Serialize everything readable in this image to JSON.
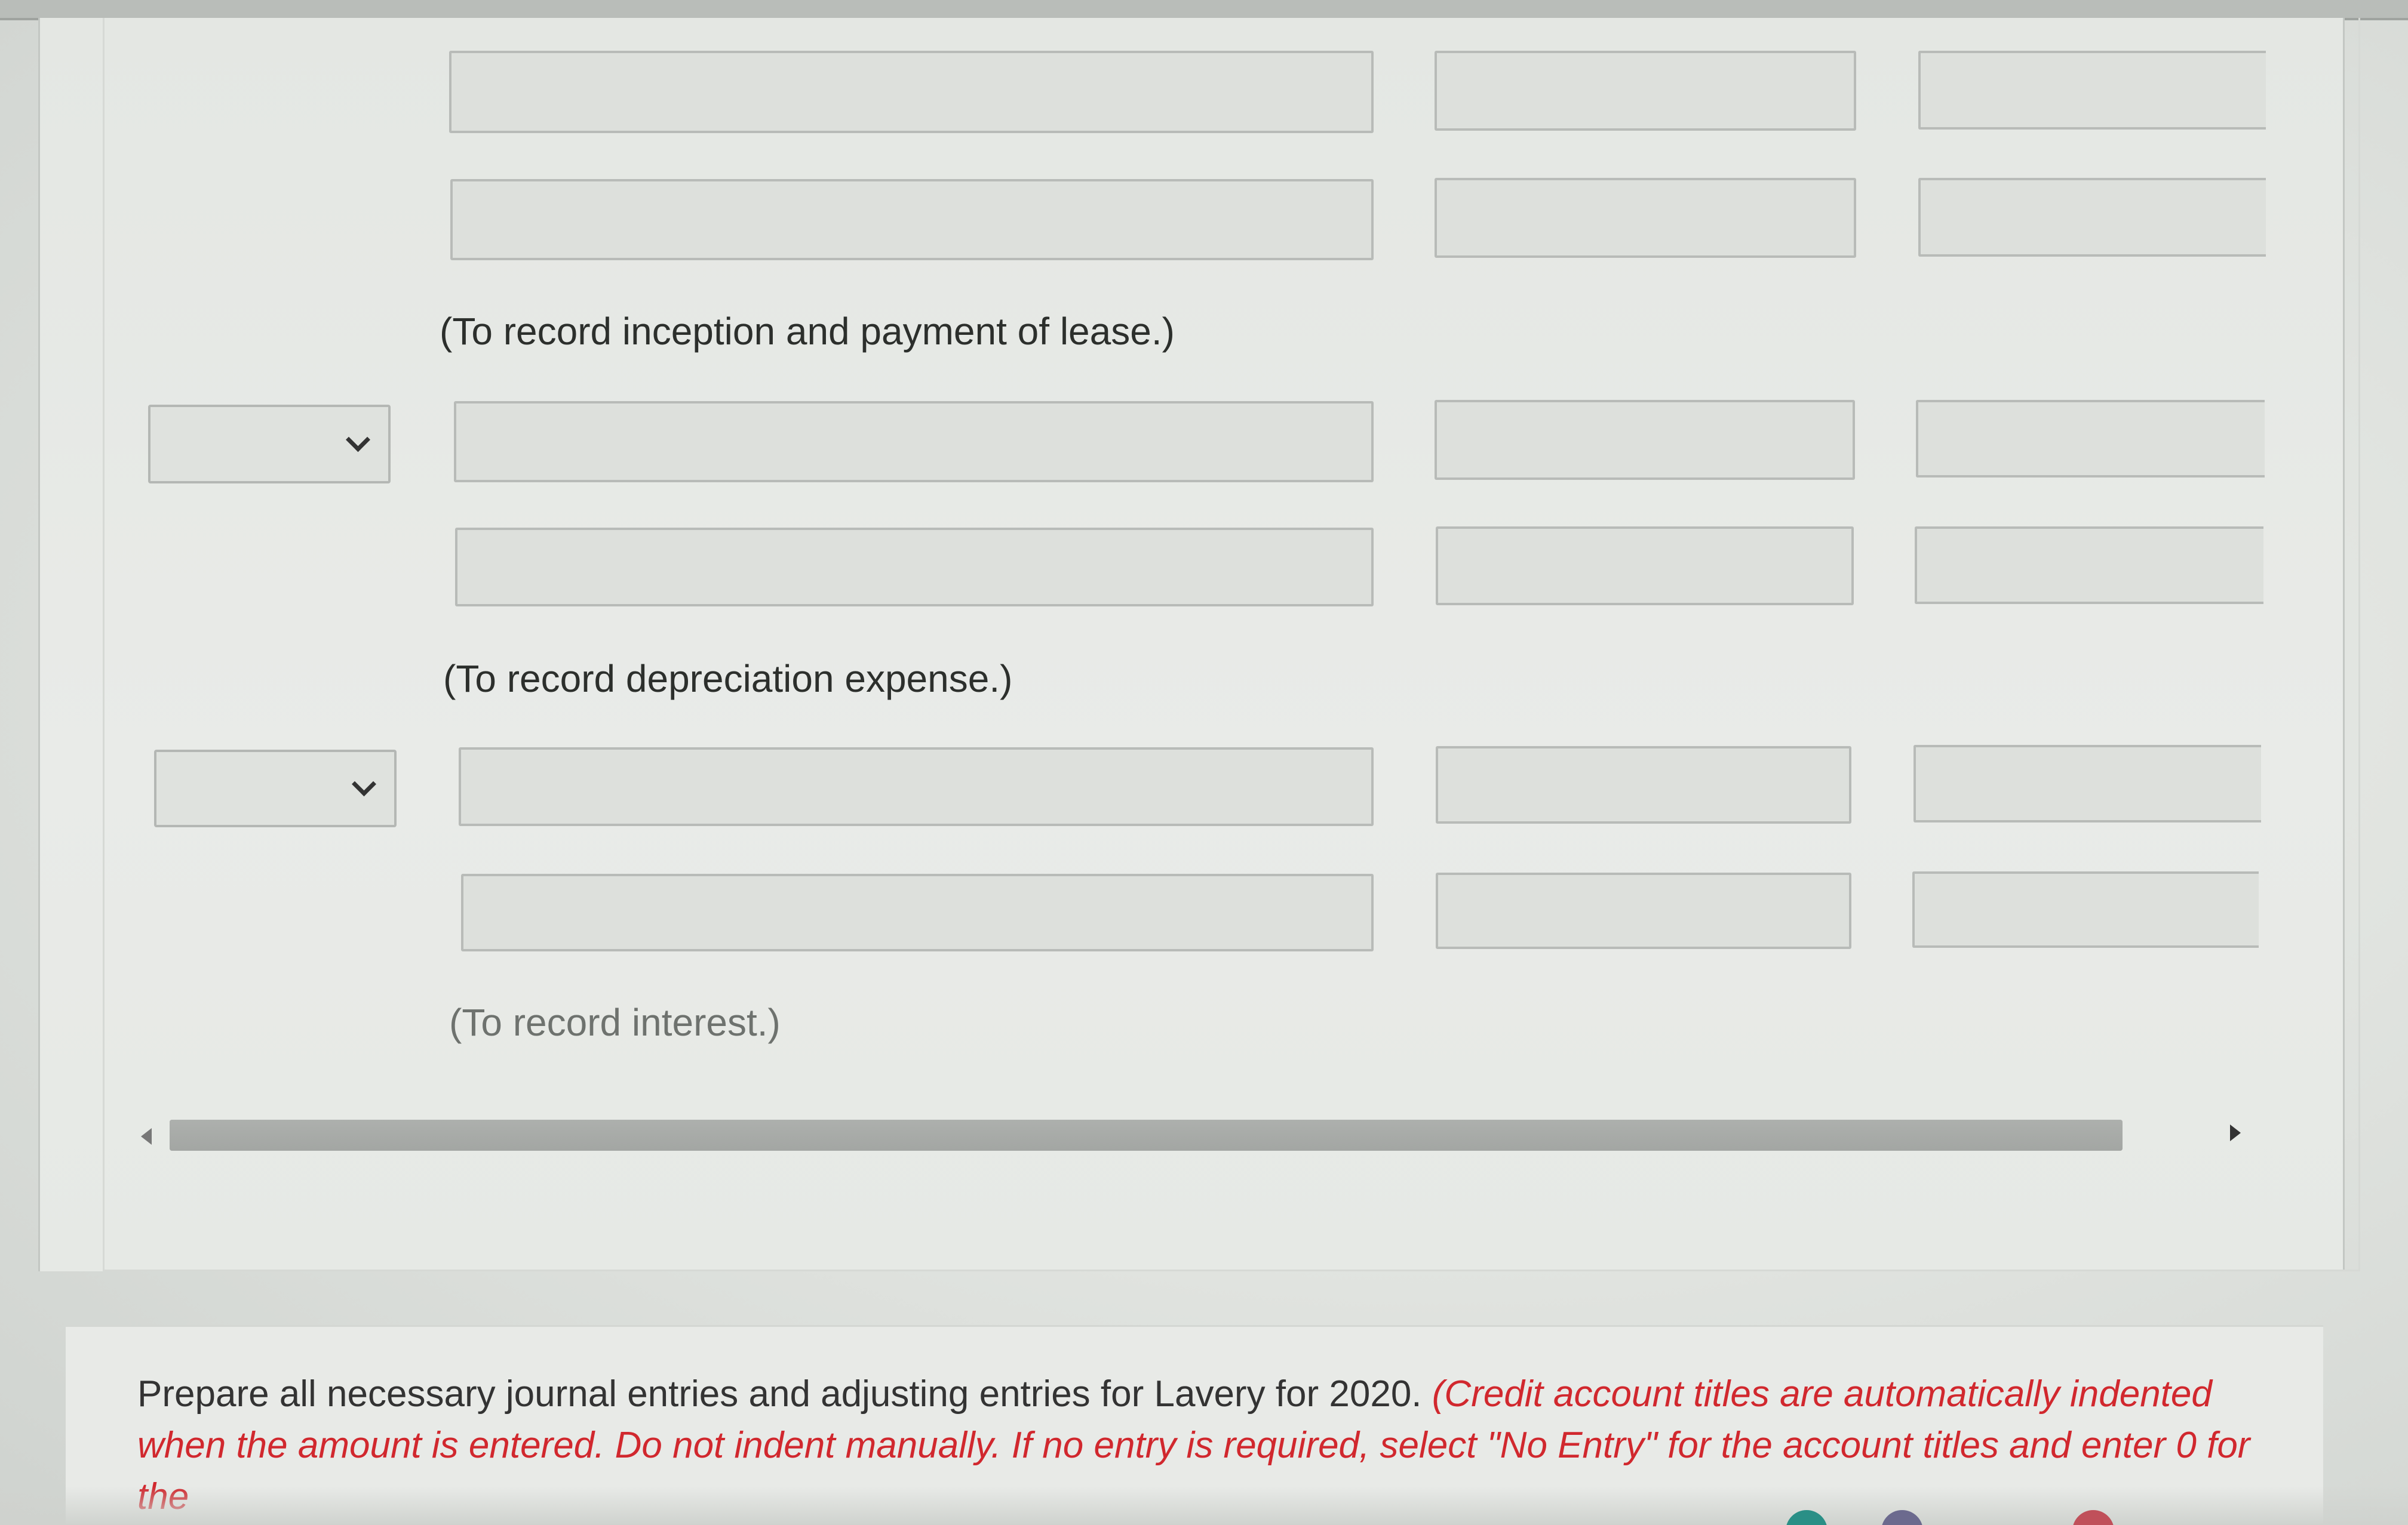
{
  "entries": [
    {
      "note": "(To record inception and payment of lease.)"
    },
    {
      "note": "(To record depreciation expense.)"
    },
    {
      "note": "(To record interest.)"
    }
  ],
  "instructions": {
    "text": "Prepare all necessary journal entries and adjusting entries for Lavery for 2020.",
    "note_red": "(Credit account titles are automatically indented when the amount is entered. Do not indent manually. If no entry is required, select \"No Entry\" for the account titles and enter 0 for the"
  },
  "colors": {
    "accent_red": "#d1282e",
    "field_border": "#b8bbb8",
    "panel_bg": "#e6e9e5"
  },
  "icons": {
    "dropdown": "chevron-down-icon",
    "scroll_left": "caret-left-icon",
    "scroll_right": "caret-right-icon"
  }
}
